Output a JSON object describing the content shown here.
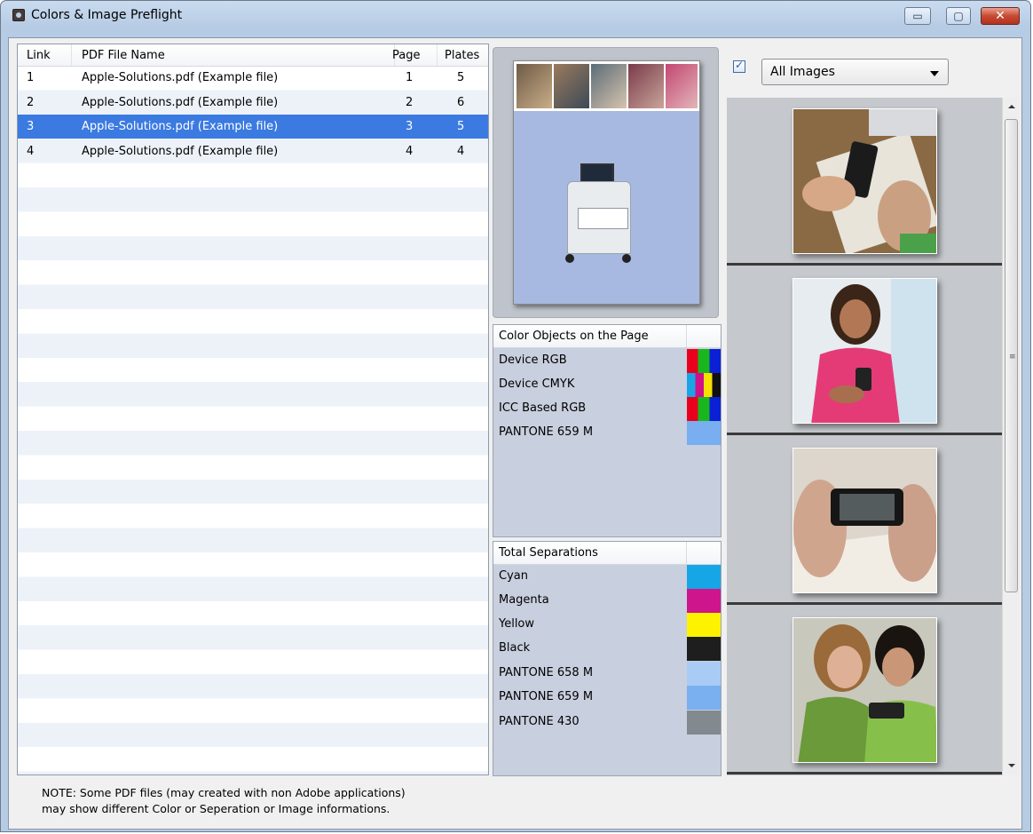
{
  "window": {
    "title": "Colors & Image Preflight",
    "minimize_glyph": "▭",
    "maximize_glyph": "▢",
    "close_glyph": "✕"
  },
  "file_table": {
    "columns": [
      "Link",
      "PDF File Name",
      "Page",
      "Plates"
    ],
    "rows": [
      {
        "link": "1",
        "name": "Apple-Solutions.pdf (Example file)",
        "page": "1",
        "plates": "5"
      },
      {
        "link": "2",
        "name": "Apple-Solutions.pdf (Example file)",
        "page": "2",
        "plates": "6"
      },
      {
        "link": "3",
        "name": "Apple-Solutions.pdf (Example file)",
        "page": "3",
        "plates": "5"
      },
      {
        "link": "4",
        "name": "Apple-Solutions.pdf (Example file)",
        "page": "4",
        "plates": "4"
      }
    ],
    "selected_row": 3
  },
  "color_objects": {
    "header": "Color Objects on the Page",
    "items": [
      {
        "label": "Device RGB",
        "swatch": [
          "#e8001c",
          "#19b71d",
          "#0a1fd6"
        ]
      },
      {
        "label": "Device CMYK",
        "swatch": [
          "#1aa4e6",
          "#d00f8a",
          "#f7e000",
          "#111111"
        ]
      },
      {
        "label": "ICC Based RGB",
        "swatch": [
          "#e8001c",
          "#19b71d",
          "#0a1fd6"
        ]
      },
      {
        "label": "PANTONE 659 M",
        "swatch": [
          "#79aef0"
        ]
      }
    ]
  },
  "separations": {
    "header": "Total Separations",
    "items": [
      {
        "label": "Cyan",
        "color": "#16a6e6"
      },
      {
        "label": "Magenta",
        "color": "#cf158c"
      },
      {
        "label": "Yellow",
        "color": "#fdf200"
      },
      {
        "label": "Black",
        "color": "#1e1e1e"
      },
      {
        "label": "PANTONE 658 M",
        "color": "#a9ccf4"
      },
      {
        "label": "PANTONE 659 M",
        "color": "#7aaff0"
      },
      {
        "label": "PANTONE 430",
        "color": "#838a8f"
      }
    ]
  },
  "images": {
    "filter_checked": true,
    "filter_value": "All Images",
    "thumbnails": [
      "phone-on-book-photo",
      "girl-with-phone-photo",
      "hands-holding-phone-photo",
      "two-girls-with-phone-photo"
    ]
  },
  "note": {
    "line1": "NOTE: Some PDF files (may created with non Adobe applications)",
    "line2": "may show different Color or Seperation or Image informations."
  }
}
